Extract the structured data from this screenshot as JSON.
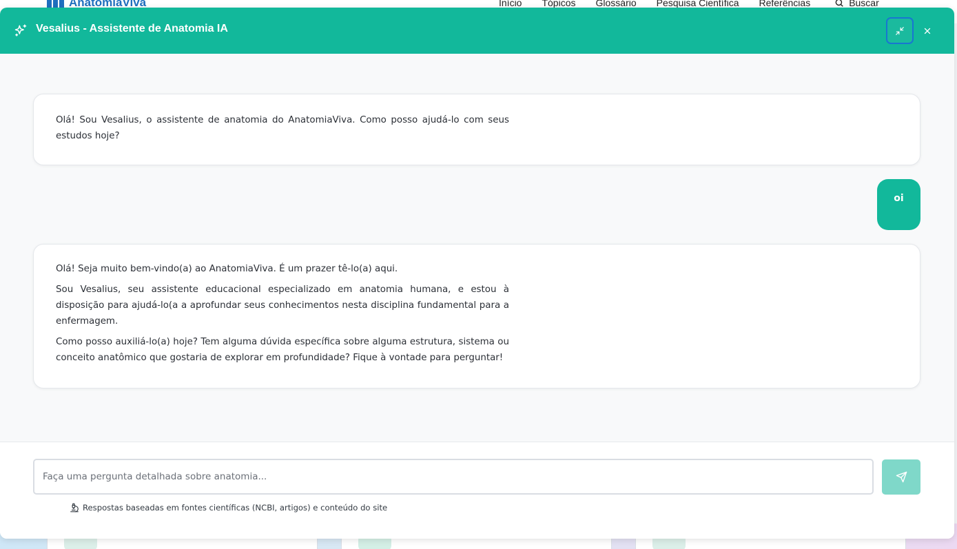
{
  "site": {
    "logo": "AnatomiaViva",
    "nav": [
      "Início",
      "Tópicos",
      "Glossário",
      "Pesquisa Científica",
      "Referências"
    ],
    "search_label": "Buscar"
  },
  "chat": {
    "title": "Vesalius - Assistente de Anatomia IA",
    "messages": [
      {
        "role": "assistant",
        "paragraphs": [
          "Olá! Sou Vesalius, o assistente de anatomia do AnatomiaViva. Como posso ajudá-lo com seus estudos hoje?"
        ]
      },
      {
        "role": "user",
        "text": "oi"
      },
      {
        "role": "assistant",
        "paragraphs": [
          "Olá! Seja muito bem-vindo(a) ao AnatomiaViva. É um prazer tê-lo(a) aqui.",
          "Sou Vesalius, seu assistente educacional especializado em anatomia humana, e estou à disposição para ajudá-lo(a a aprofundar seus conhecimentos nesta disciplina fundamental para a enfermagem.",
          "Como posso auxiliá-lo(a) hoje? Tem alguma dúvida específica sobre alguma estrutura, sistema ou conceito anatômico que gostaria de explorar em profundidade? Fique à vontade para perguntar!"
        ]
      }
    ],
    "input_placeholder": "Faça uma pergunta detalhada sobre anatomia...",
    "disclaimer": "Respostas baseadas em fontes científicas (NCBI, artigos) e conteúdo do site",
    "icons": {
      "header": "sparkles-icon",
      "minimize": "minimize-icon",
      "close": "close-icon",
      "send": "send-icon",
      "disclaimer": "microscope-icon"
    }
  },
  "colors": {
    "accent": "#12b89b",
    "send_disabled": "#7fd8c9",
    "focus_ring": "#1876d2",
    "logo": "#1f6fbf"
  }
}
